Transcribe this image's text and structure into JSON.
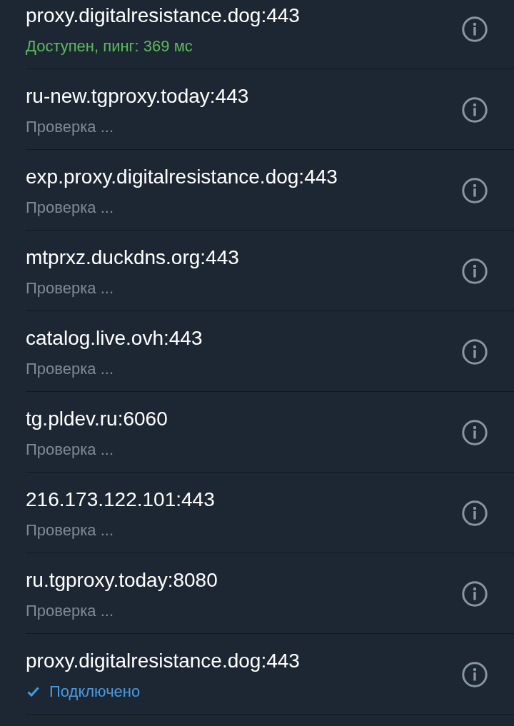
{
  "proxies": [
    {
      "address": "proxy.digitalresistance.dog:443",
      "kind": "available",
      "status": "Доступен, пинг: 369 мс"
    },
    {
      "address": "ru-new.tgproxy.today:443",
      "kind": "checking",
      "status": "Проверка ..."
    },
    {
      "address": "exp.proxy.digitalresistance.dog:443",
      "kind": "checking",
      "status": "Проверка ..."
    },
    {
      "address": "mtprxz.duckdns.org:443",
      "kind": "checking",
      "status": "Проверка ..."
    },
    {
      "address": "catalog.live.ovh:443",
      "kind": "checking",
      "status": "Проверка ..."
    },
    {
      "address": "tg.pldev.ru:6060",
      "kind": "checking",
      "status": "Проверка ..."
    },
    {
      "address": "216.173.122.101:443",
      "kind": "checking",
      "status": "Проверка ..."
    },
    {
      "address": "ru.tgproxy.today:8080",
      "kind": "checking",
      "status": "Проверка ..."
    },
    {
      "address": "proxy.digitalresistance.dog:443",
      "kind": "connected",
      "status": "Подключено"
    }
  ]
}
